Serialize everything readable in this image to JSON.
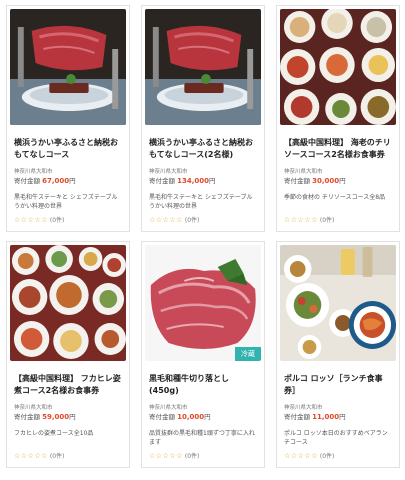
{
  "products": [
    {
      "title": "横浜うかい亭ふるさと納税おもてなしコース",
      "region": "神奈川県大和市",
      "price_label": "寄付金額",
      "price": "67,000",
      "price_unit": "円",
      "description": "黒毛和牛ステーキと シェフズテーブル　うかい料理の世界",
      "stars": "☆☆☆☆☆",
      "reviews": "(0件)",
      "badge": ""
    },
    {
      "title": "横浜うかい亭ふるさと納税おもてなしコース(2名様)",
      "region": "神奈川県大和市",
      "price_label": "寄付金額",
      "price": "134,000",
      "price_unit": "円",
      "description": "黒毛和牛ステーキと シェフズテーブル　うかい料理の世界",
      "stars": "☆☆☆☆☆",
      "reviews": "(0件)",
      "badge": ""
    },
    {
      "title": "【高級中国料理】 海老のチリソースコース2名様お食事券",
      "region": "神奈川県大和市",
      "price_label": "寄付金額",
      "price": "30,000",
      "price_unit": "円",
      "description": "季節の食材の チリソースコース全8品",
      "stars": "☆☆☆☆☆",
      "reviews": "(0件)",
      "badge": ""
    },
    {
      "title": "【高級中国料理】 フカヒレ姿煮コース2名様お食事券",
      "region": "神奈川県大和市",
      "price_label": "寄付金額",
      "price": "59,000",
      "price_unit": "円",
      "description": "フカヒレの姿煮コース全10品",
      "stars": "☆☆☆☆☆",
      "reviews": "(0件)",
      "badge": ""
    },
    {
      "title": "黒毛和種牛切り落とし(450g)",
      "region": "神奈川県大和市",
      "price_label": "寄付金額",
      "price": "10,000",
      "price_unit": "円",
      "description": "品質抜群の黒毛和種1頭ずつ丁寧に入れます",
      "stars": "☆☆☆☆☆",
      "reviews": "(0件)",
      "badge": "冷蔵"
    },
    {
      "title": "ポルコ ロッソ［ランチ食事券］",
      "region": "神奈川県大和市",
      "price_label": "寄付金額",
      "price": "11,000",
      "price_unit": "円",
      "description": "ポルコ ロッソ本日のおすすめペアランチコース",
      "stars": "☆☆☆☆☆",
      "reviews": "(0件)",
      "badge": ""
    }
  ]
}
